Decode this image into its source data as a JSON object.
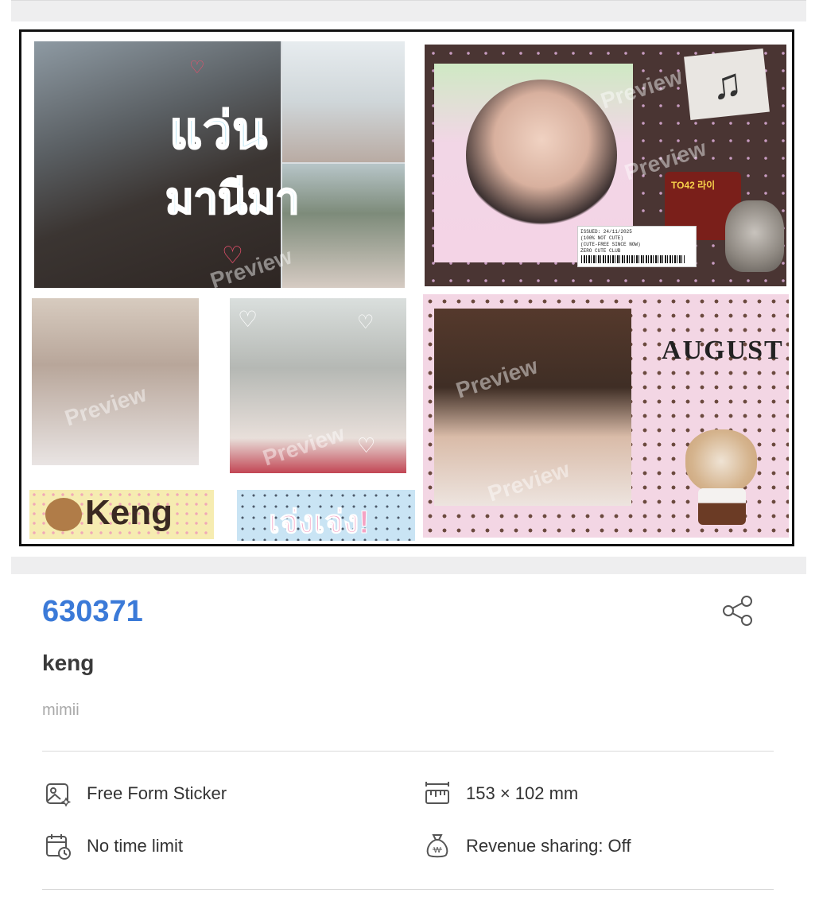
{
  "sheet": {
    "thai_title": "แว่น",
    "thai_subtitle": "มานีมา",
    "label_keng": "Keng",
    "label_thai": "เจ่งเจ่ง!",
    "august_text": "AUGUST",
    "ticket_lines": [
      "ISSUED: 24/11/2025",
      "(100% NOT CUTE)",
      "(CUTE-FREE SINCE NOW)",
      "ZERO CUTE CLUB",
      "ADMISSION"
    ],
    "noodle_text": "TO42 라이",
    "watermark": "Preview",
    "colors": {
      "brown_bg": "#4a3533",
      "pink_bg": "#f3d6e4",
      "yellow_label": "#f6ecb1",
      "blue_label": "#c9e4f4"
    }
  },
  "product": {
    "code": "630371",
    "title": "keng",
    "author": "mimii",
    "share_icon": "share-icon",
    "code_color": "#3b7ad8"
  },
  "specs": [
    {
      "icon": "image-sparkle-icon",
      "value": "Free Form Sticker"
    },
    {
      "icon": "ruler-icon",
      "value": "153 × 102 mm"
    },
    {
      "icon": "calendar-clock-icon",
      "value": "No time limit"
    },
    {
      "icon": "money-bag-icon",
      "value": "Revenue sharing: Off"
    }
  ]
}
